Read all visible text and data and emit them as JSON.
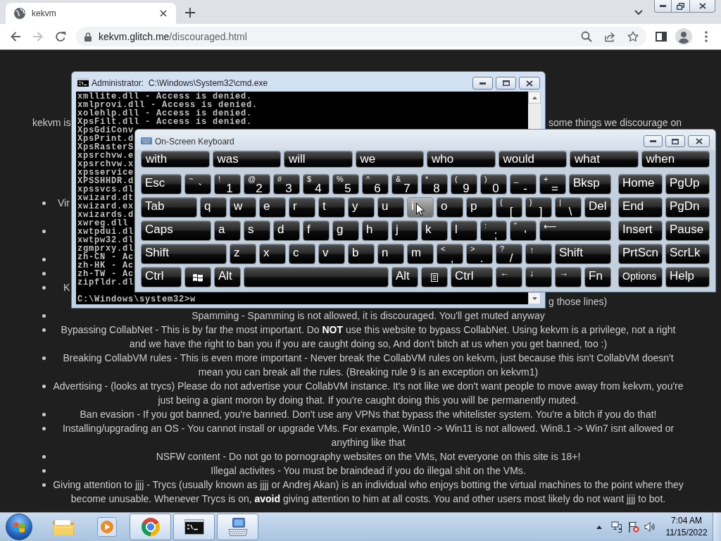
{
  "browser": {
    "tabs": [
      {
        "title": "kekvm",
        "selected": true
      }
    ],
    "toolbar": {
      "back": {
        "disabled": false
      },
      "forward": {
        "disabled": true
      }
    },
    "url": {
      "host": "kekvm.glitch.me",
      "path": "/discouraged.html"
    }
  },
  "page": {
    "intro": {
      "left": "kekvm is",
      "right": "some things we discourage on"
    },
    "covered_items": [
      {
        "kind": "fragment",
        "left": "Vir"
      },
      {
        "kind": "hidden"
      },
      {
        "kind": "hidden"
      },
      {
        "kind": "hidden"
      },
      {
        "kind": "fragment",
        "left": "K",
        "right": "g those lines)"
      }
    ],
    "rules": [
      "Spamming - Spamming is not allowed, it is discouraged. You'll get muted anyway",
      "Bypassing CollabNet - This is by far the most important. Do **NOT** use this website to bypass CollabNet. Using kekvm is a privilege, not a right and we have the right to ban you if you are caught doing so, And don't bitch at us when you get banned, too :)",
      "Breaking CollabVM rules - This is even more important - Never break the CollabVM rules on kekvm, just because this isn't CollabVM doesn't mean you can break all the rules. (Breaking rule 9 is an exception on kekvm1)",
      "Advertising - (looks at trycs) Please do not advertise your CollabVM instance. It's not like we don't want people to move away from kekvm, you're just being a giant moron by doing that. If you're caught doing this you will be permanently muted.",
      "Ban evasion - If you got banned, you're banned. Don't use any VPNs that bypass the whitelister system. You're a bitch if you do that!",
      "Installing/upgrading an OS - You cannot install or upgrade VMs. For example, Win10 -> Win11 is not allowed. Win8.1 -> Win7 isnt allowed or anything like that",
      "NSFW content - Do not go to pornography websites on the VMs, Not everyone on this site is 18+!",
      "Illegal activites - You must be braindead if you do illegal shit on the VMs.",
      "Giving attention to jjjj - Trycs (usually known as jjjj or Andrej Akan) is an individual who enjoys botting the virtual machines to the point where they become unusable. Whenever Trycs is on, **avoid** giving attention to him at all costs. You and other users most likely do not want jjjj to bot."
    ]
  },
  "console_window": {
    "title": "Administrator:  C:\\Windows\\System32\\cmd.exe",
    "output": [
      "xmllite.dll - Access is denied.",
      "xmlprovi.dll - Access is denied.",
      "xolehlp.dll - Access is denied.",
      "XpsFilt.dll - Access is denied.",
      "XpsGdiConv",
      "XpsPrint.d",
      "XpsRasterS",
      "xpsrchvw.e",
      "xpsrchvw.x",
      "xpsservice",
      "XPSSHHDR.d",
      "xpssvcs.dl",
      "xwizard.dt",
      "xwizard.ex",
      "xwizards.d",
      "xwreg.dll",
      "xwtpdui.dl",
      "xwtpw32.dl",
      "zgmprxy.dl",
      "zh-CN - Ac",
      "zh-HK - Ac",
      "zh-TW - Ac",
      "zipfldr.dl"
    ],
    "prompt": "C:\\Windows\\system32>w"
  },
  "keyboard_window": {
    "title": "On-Screen Keyboard",
    "suggestions": [
      "with",
      "was",
      "will",
      "we",
      "who",
      "would",
      "what",
      "when"
    ],
    "main_rows": [
      [
        {
          "kind": "text",
          "label": "Esc",
          "hovered": false
        },
        {
          "kind": "dual",
          "top": "~",
          "label": "`",
          "hovered": false
        },
        {
          "kind": "dual",
          "top": "!",
          "label": "1",
          "hovered": false
        },
        {
          "kind": "dual",
          "top": "@",
          "label": "2",
          "hovered": false
        },
        {
          "kind": "dual",
          "top": "#",
          "label": "3",
          "hovered": false
        },
        {
          "kind": "dual",
          "top": "$",
          "label": "4",
          "hovered": false
        },
        {
          "kind": "dual",
          "top": "%",
          "label": "5",
          "hovered": false
        },
        {
          "kind": "dual",
          "top": "^",
          "label": "6",
          "hovered": false
        },
        {
          "kind": "dual",
          "top": "&",
          "label": "7",
          "hovered": false
        },
        {
          "kind": "dual",
          "top": "*",
          "label": "8",
          "hovered": false
        },
        {
          "kind": "dual",
          "top": "(",
          "label": "9",
          "hovered": false
        },
        {
          "kind": "dual",
          "top": ")",
          "label": "0",
          "hovered": false
        },
        {
          "kind": "dual",
          "top": "_",
          "label": "-",
          "hovered": false
        },
        {
          "kind": "dual",
          "top": "+",
          "label": "=",
          "hovered": false
        },
        {
          "kind": "text",
          "label": "Bksp",
          "hovered": false
        }
      ],
      [
        {
          "kind": "text",
          "label": "Tab",
          "hovered": false
        },
        {
          "kind": "text",
          "label": "q",
          "hovered": false
        },
        {
          "kind": "text",
          "label": "w",
          "hovered": false
        },
        {
          "kind": "text",
          "label": "e",
          "hovered": false
        },
        {
          "kind": "text",
          "label": "r",
          "hovered": false
        },
        {
          "kind": "text",
          "label": "t",
          "hovered": false
        },
        {
          "kind": "text",
          "label": "y",
          "hovered": false
        },
        {
          "kind": "text",
          "label": "u",
          "hovered": false
        },
        {
          "kind": "text",
          "label": "i",
          "hovered": true
        },
        {
          "kind": "text",
          "label": "o",
          "hovered": false
        },
        {
          "kind": "text",
          "label": "p",
          "hovered": false
        },
        {
          "kind": "dual",
          "top": "{",
          "label": "[",
          "hovered": false
        },
        {
          "kind": "dual",
          "top": "}",
          "label": "]",
          "hovered": false
        },
        {
          "kind": "dual",
          "top": "|",
          "label": "\\",
          "hovered": false
        },
        {
          "kind": "text",
          "label": "Del",
          "hovered": false
        }
      ],
      [
        {
          "kind": "text",
          "label": "Caps",
          "hovered": false
        },
        {
          "kind": "text",
          "label": "a",
          "hovered": false
        },
        {
          "kind": "text",
          "label": "s",
          "hovered": false
        },
        {
          "kind": "text",
          "label": "d",
          "hovered": false
        },
        {
          "kind": "text",
          "label": "f",
          "hovered": false
        },
        {
          "kind": "text",
          "label": "g",
          "hovered": false
        },
        {
          "kind": "text",
          "label": "h",
          "hovered": false
        },
        {
          "kind": "text",
          "label": "j",
          "hovered": false
        },
        {
          "kind": "text",
          "label": "k",
          "hovered": false
        },
        {
          "kind": "text",
          "label": "l",
          "hovered": false
        },
        {
          "kind": "dual",
          "top": ":",
          "label": ";",
          "hovered": false
        },
        {
          "kind": "dual",
          "top": "\"",
          "label": "'",
          "hovered": false
        },
        {
          "kind": "arrow",
          "label": "⟵",
          "hovered": false
        }
      ],
      [
        {
          "kind": "text",
          "label": "Shift",
          "hovered": false
        },
        {
          "kind": "text",
          "label": "z",
          "hovered": false
        },
        {
          "kind": "text",
          "label": "x",
          "hovered": false
        },
        {
          "kind": "text",
          "label": "c",
          "hovered": false
        },
        {
          "kind": "text",
          "label": "v",
          "hovered": false
        },
        {
          "kind": "text",
          "label": "b",
          "hovered": false
        },
        {
          "kind": "text",
          "label": "n",
          "hovered": false
        },
        {
          "kind": "text",
          "label": "m",
          "hovered": false
        },
        {
          "kind": "dual",
          "top": "<",
          "label": ",",
          "hovered": false
        },
        {
          "kind": "dual",
          "top": ">",
          "label": ".",
          "hovered": false
        },
        {
          "kind": "dual",
          "top": "?",
          "label": "/",
          "hovered": false
        },
        {
          "kind": "arrow",
          "label": "↑",
          "hovered": false
        },
        {
          "kind": "text",
          "label": "Shift",
          "hovered": false
        }
      ],
      [
        {
          "kind": "text",
          "label": "Ctrl",
          "hovered": false
        },
        {
          "kind": "winkey",
          "hovered": false
        },
        {
          "kind": "text",
          "label": "Alt",
          "hovered": false
        },
        {
          "kind": "space",
          "hovered": false
        },
        {
          "kind": "text",
          "label": "Alt",
          "hovered": false
        },
        {
          "kind": "menukey",
          "hovered": false
        },
        {
          "kind": "text",
          "label": "Ctrl",
          "hovered": false
        },
        {
          "kind": "arrow",
          "label": "←",
          "hovered": false
        },
        {
          "kind": "arrow",
          "label": "↓",
          "hovered": false
        },
        {
          "kind": "arrow",
          "label": "→",
          "hovered": false
        },
        {
          "kind": "text",
          "label": "Fn",
          "hovered": false
        }
      ]
    ],
    "nav_rows": [
      [
        {
          "kind": "text",
          "label": "Home",
          "hovered": false
        },
        {
          "kind": "text",
          "label": "PgUp",
          "hovered": false
        }
      ],
      [
        {
          "kind": "text",
          "label": "End",
          "hovered": false
        },
        {
          "kind": "text",
          "label": "PgDn",
          "hovered": false
        }
      ],
      [
        {
          "kind": "text",
          "label": "Insert",
          "hovered": false
        },
        {
          "kind": "text",
          "label": "Pause",
          "hovered": false
        }
      ],
      [
        {
          "kind": "text",
          "label": "PrtScn",
          "hovered": false
        },
        {
          "kind": "text",
          "label": "ScrLk",
          "hovered": false
        }
      ],
      [
        {
          "kind": "text",
          "label": "Options",
          "hovered": false
        },
        {
          "kind": "text",
          "label": "Help",
          "hovered": false
        }
      ]
    ]
  },
  "taskbar": {
    "apps": [
      {
        "kind": "folder",
        "running": false
      },
      {
        "kind": "player",
        "running": false
      },
      {
        "kind": "browser",
        "running": true
      },
      {
        "kind": "console",
        "running": true
      },
      {
        "kind": "keyboard",
        "running": true
      }
    ],
    "clock": {
      "time": "7:04 AM",
      "date": "11/15/2022"
    }
  }
}
